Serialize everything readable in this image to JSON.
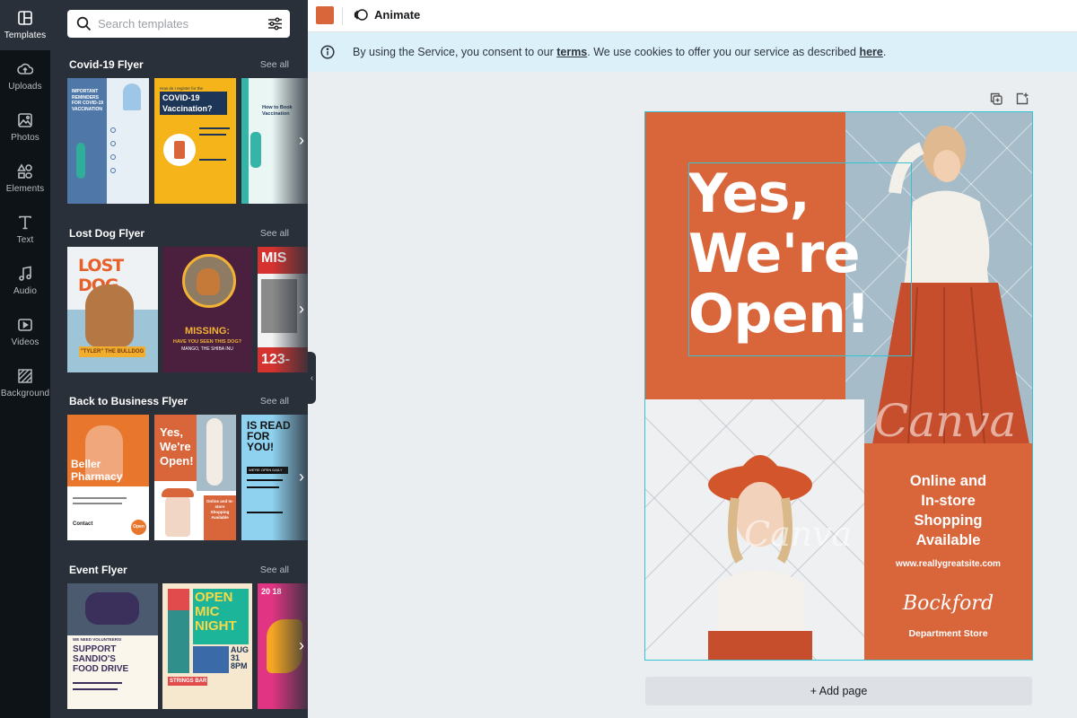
{
  "rail": {
    "items": [
      {
        "label": "Templates",
        "icon": "templates-icon"
      },
      {
        "label": "Uploads",
        "icon": "uploads-icon"
      },
      {
        "label": "Photos",
        "icon": "photos-icon"
      },
      {
        "label": "Elements",
        "icon": "elements-icon"
      },
      {
        "label": "Text",
        "icon": "text-icon"
      },
      {
        "label": "Audio",
        "icon": "audio-icon"
      },
      {
        "label": "Videos",
        "icon": "videos-icon"
      },
      {
        "label": "Background",
        "icon": "background-icon"
      }
    ]
  },
  "search": {
    "placeholder": "Search templates"
  },
  "sections": [
    {
      "title": "Covid-19 Flyer",
      "see_all": "See all",
      "thumbs": [
        {
          "label": "IMPORTANT REMINDERS FOR COVID-19 VACCINATION"
        },
        {
          "label": "COVID-19 Vaccination?",
          "sub": "How do I register for the"
        },
        {
          "label": "How to Book Vaccination"
        }
      ]
    },
    {
      "title": "Lost Dog Flyer",
      "see_all": "See all",
      "thumbs": [
        {
          "label": "LOST DOG",
          "sub": "\"TYLER\" THE BULLDOG"
        },
        {
          "label": "MISSING:",
          "sub": "HAVE YOU SEEN THIS DOG?",
          "sub2": "MANGO, THE SHIBA INU"
        },
        {
          "label": "MIS",
          "sub": "123-"
        }
      ]
    },
    {
      "title": "Back to Business Flyer",
      "see_all": "See all",
      "thumbs": [
        {
          "label": "Beller Pharmacy",
          "sub": "Contact",
          "badge": "Open"
        },
        {
          "label": "Yes, We're Open!",
          "sub": "Online and In-store Shopping Available"
        },
        {
          "label": "IS READ FOR YOU!",
          "sub": "WE'RE OPEN DAILY"
        }
      ]
    },
    {
      "title": "Event Flyer",
      "see_all": "See all",
      "thumbs": [
        {
          "label": "SUPPORT SANDIO'S FOOD DRIVE",
          "sub": "WE NEED VOLUNTEERS!"
        },
        {
          "label": "OPEN MIC NIGHT",
          "sub": "AUG 31 8PM",
          "sub2": "STRINGS BAR"
        },
        {
          "label": "20 18"
        }
      ]
    }
  ],
  "topbar": {
    "animate_label": "Animate",
    "swatch_color": "#d9653b"
  },
  "banner": {
    "text_before": "By using the Service, you consent to our ",
    "terms_link": "terms",
    "text_middle": ". We use cookies to offer you our service as described ",
    "here_link": "here",
    "text_after": "."
  },
  "design": {
    "headline": [
      "Yes,",
      "We're",
      "Open!"
    ],
    "online": [
      "Online and",
      "In-store",
      "Shopping",
      "Available"
    ],
    "website": "www.reallygreatsite.com",
    "signature": "Bockford",
    "department": "Department Store",
    "watermark": "Canva",
    "accent_color": "#d9653b"
  },
  "add_page_label": "+ Add page"
}
